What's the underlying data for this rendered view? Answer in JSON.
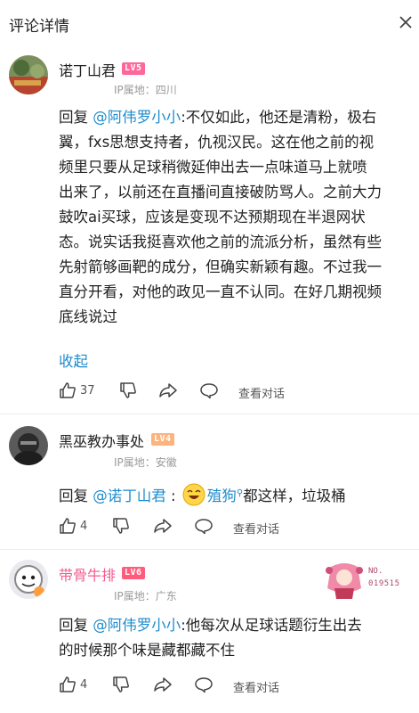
{
  "header": {
    "title": "评论详情"
  },
  "comments": [
    {
      "username": "诺丁山君",
      "level": "LV5",
      "ip": "IP属地：四川",
      "reply_prefix": "回复 ",
      "mention": "@阿伟罗小小",
      "text_lines": [
        ":不仅如此，他还是清粉，极右",
        "翼，fxs思想支持者，仇视汉民。这在他之前的视",
        "频里只要从足球稍微延伸出去一点味道马上就喷",
        "出来了，以前还在直播间直接破防骂人。之前大力",
        "鼓吹ai买球，应该是变现不达预期现在半退网状",
        "态。说实话我挺喜欢他之前的流派分析，虽然有些",
        "先射箭够画靶的成分，但确实新颖有趣。不过我一",
        "直分开看，对他的政见一直不认同。在好几期视频",
        "底线说过"
      ],
      "collapse_label": "收起",
      "like_count": "37",
      "view_conversation": "查看对话"
    },
    {
      "username": "黑巫教办事处",
      "level": "LV4",
      "ip": "IP属地：安徽",
      "reply_prefix": "回复 ",
      "mention": "@诺丁山君",
      "colon": " : ",
      "mention2": "殖狗",
      "text_tail": "都这样，垃圾桶",
      "like_count": "4",
      "view_conversation": "查看对话"
    },
    {
      "username": "带骨牛排",
      "level": "LV6",
      "ip": "IP属地：广东",
      "reply_prefix": "回复 ",
      "mention": "@阿伟罗小小",
      "text_lines": [
        ":他每次从足球话题衍生出去",
        "的时候那个味是藏都藏不住"
      ],
      "like_count": "4",
      "view_conversation": "查看对话",
      "fan_badge_label": "NO.",
      "fan_badge_number": "019515"
    }
  ],
  "colors": {
    "mention": "#1e8ccd",
    "vip_name": "#f25d8e",
    "level_lv5": "#ff6699",
    "level_lv4": "#ffb37c",
    "level_lv6": "#ff5c7c"
  }
}
